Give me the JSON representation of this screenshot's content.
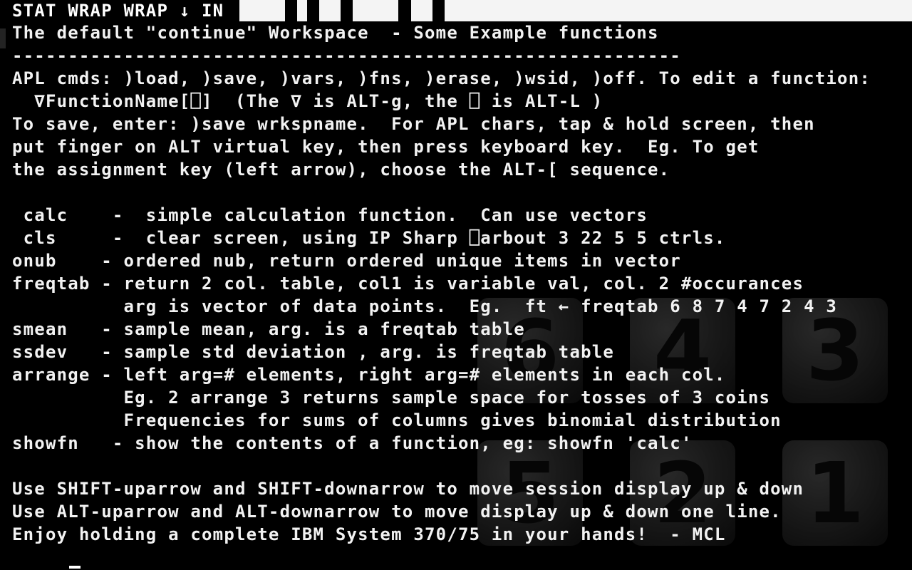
{
  "status_bar": {
    "text": "STAT WRAP WRAP ↓ IN"
  },
  "session": {
    "lines": [
      "The default \"continue\" Workspace  - Some Example functions",
      "------------------------------------------------------------",
      "",
      "APL cmds: )load, )save, )vars, )fns, )erase, )wsid, )off. To edit a function:",
      "  ∇FunctionName[⎕]  (The ∇ is ALT-g, the ⎕ is ALT-L )",
      "To save, enter: )save wrkspname.  For APL chars, tap & hold screen, then",
      "put finger on ALT virtual key, then press keyboard key.  Eg. To get",
      "the assignment key (left arrow), choose the ALT-[ sequence.",
      "",
      " calc    -  simple calculation function.  Can use vectors",
      " cls     -  clear screen, using IP Sharp ⎕arbout 3 22 5 5 ctrls.",
      "onub    - ordered nub, return ordered unique items in vector",
      "freqtab - return 2 col. table, col1 is variable val, col. 2 #occurances",
      "          arg is vector of data points.  Eg.  ft ← freqtab 6 8 7 4 7 2 4 3",
      "smean   - sample mean, arg. is a freqtab table",
      "ssdev   - sample std deviation , arg. is freqtab table",
      "arrange - left arg=# elements, right arg=# elements in each col.",
      "          Eg. 2 arrange 3 returns sample space for tosses of 3 coins",
      "          Frequencies for sums of columns gives binomial distribution",
      "showfn   - show the contents of a function, eg: showfn 'calc'",
      "",
      "Use SHIFT-uparrow and SHIFT-downarrow to move session display up & down",
      "Use ALT-uparrow and ALT-downarrow to move display up & down one line.",
      "Enjoy holding a complete IBM System 370/75 in your hands!  - MCL"
    ]
  },
  "background_dice": [
    "6",
    "4",
    "3",
    "5",
    "2",
    "1"
  ],
  "colors": {
    "background": "#000000",
    "text": "#f2f2f2"
  }
}
